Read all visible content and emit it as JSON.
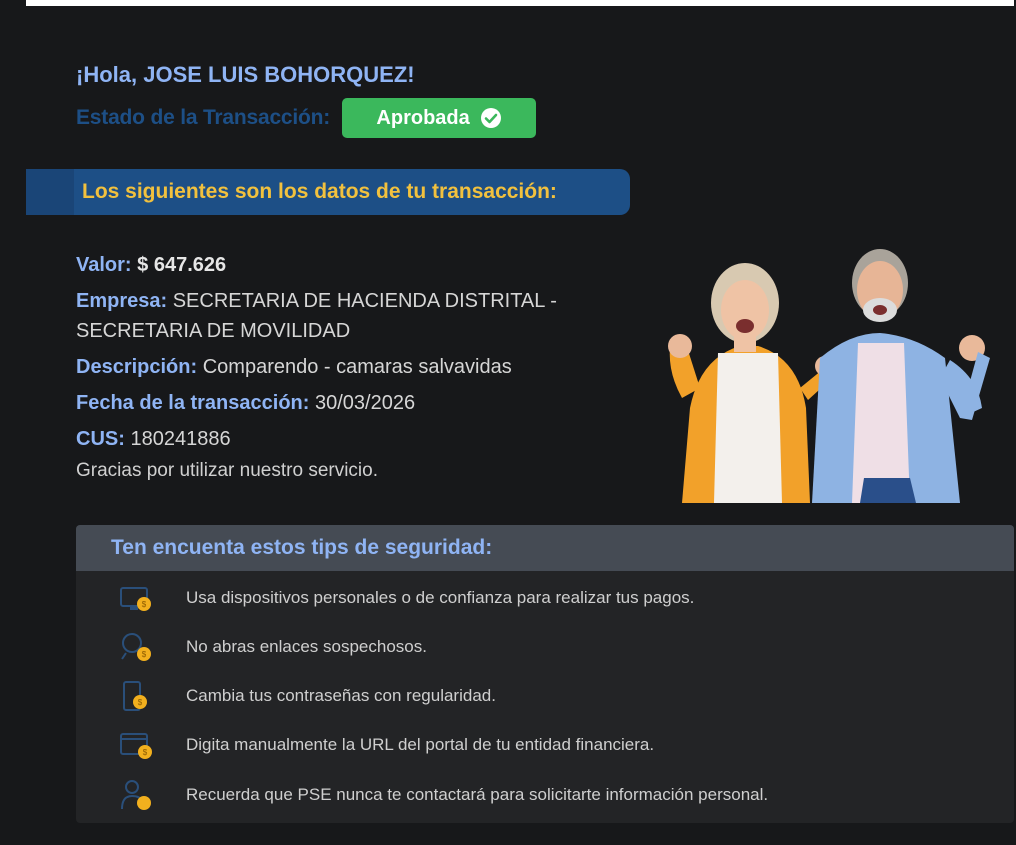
{
  "greeting": "¡Hola, JOSE LUIS BOHORQUEZ!",
  "status": {
    "label": "Estado de la Transacción:",
    "value": "Aprobada",
    "color": "#3bb85c"
  },
  "section_title": "Los siguientes son los datos de tu transacción:",
  "details": {
    "valor_label": "Valor:",
    "valor_value": "$ 647.626",
    "empresa_label": "Empresa:",
    "empresa_value": "SECRETARIA DE HACIENDA DISTRITAL - SECRETARIA DE MOVILIDAD",
    "descripcion_label": "Descripción:",
    "descripcion_value": "Comparendo - camaras salvavidas",
    "fecha_label": "Fecha de la transacción:",
    "fecha_value": "30/03/2026",
    "cus_label": "CUS:",
    "cus_value": "180241886"
  },
  "thanks": "Gracias por utilizar nuestro servicio.",
  "tips": {
    "title": "Ten encuenta estos tips de seguridad:",
    "items": [
      {
        "icon": "monitor-lock-icon",
        "text": "Usa dispositivos personales o de confianza para realizar tus pagos."
      },
      {
        "icon": "link-lock-icon",
        "text": "No abras enlaces sospechosos."
      },
      {
        "icon": "phone-lock-icon",
        "text": "Cambia tus contraseñas con regularidad."
      },
      {
        "icon": "browser-lock-icon",
        "text": "Digita manualmente la URL del portal de tu entidad financiera."
      },
      {
        "icon": "person-lock-icon",
        "text": "Recuerda que PSE nunca te contactará para solicitarte información personal."
      }
    ]
  },
  "colors": {
    "accent_blue": "#8fb4f4",
    "banner_blue": "#1d4f86",
    "banner_text": "#f2c13e",
    "tip_icon_yellow": "#f2b01e"
  }
}
